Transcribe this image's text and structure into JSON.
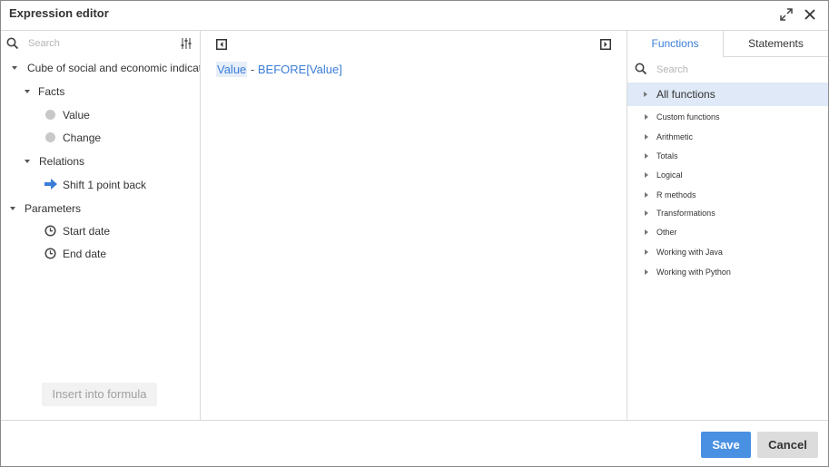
{
  "dialog": {
    "title": "Expression editor",
    "maximize_icon": "expand-icon",
    "close_icon": "close-icon"
  },
  "left_panel": {
    "search_placeholder": "Search",
    "tree": {
      "cube_label": "Cube of social and economic indicators",
      "facts_label": "Facts",
      "facts": [
        "Value",
        "Change"
      ],
      "relations_label": "Relations",
      "relations": [
        "Shift 1 point back"
      ],
      "parameters_label": "Parameters",
      "parameters": [
        "Start date",
        "End date"
      ]
    },
    "insert_button": "Insert into formula"
  },
  "editor": {
    "formula": {
      "token1": "Value",
      "op": " - ",
      "token2": "BEFORE[Value]"
    }
  },
  "right_panel": {
    "tabs": [
      "Functions",
      "Statements"
    ],
    "active_tab": "Functions",
    "search_placeholder": "Search",
    "all_functions": "All functions",
    "categories": [
      "Custom functions",
      "Arithmetic",
      "Totals",
      "Logical",
      "R methods",
      "Transformations",
      "Other",
      "Working with Java",
      "Working with Python"
    ]
  },
  "footer": {
    "save_label": "Save",
    "cancel_label": "Cancel"
  },
  "colors": {
    "accent": "#4a90e2",
    "token_blue": "#3b7dd8",
    "selected_row": "#dfe9f7"
  }
}
